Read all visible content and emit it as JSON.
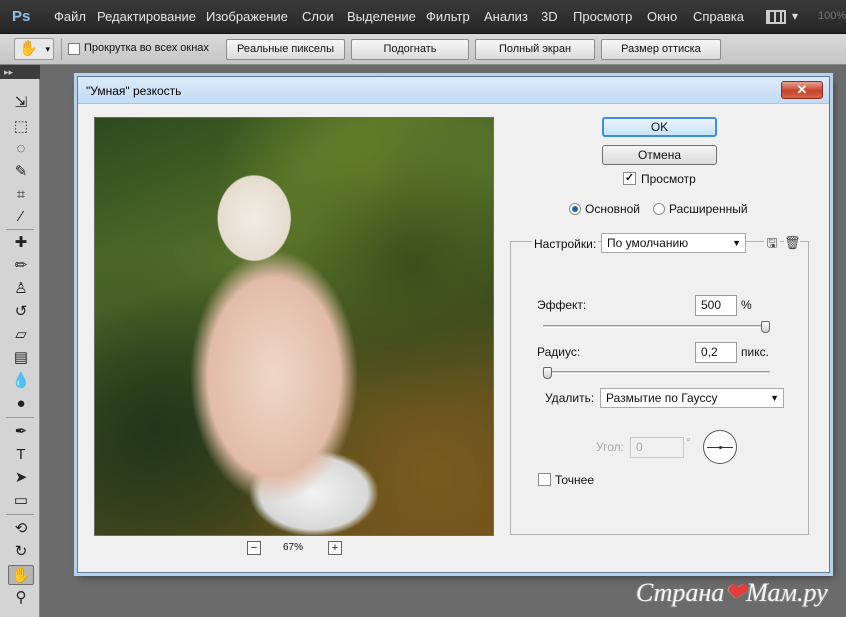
{
  "menubar": {
    "logo": "Ps",
    "items": [
      "Файл",
      "Редактирование",
      "Изображение",
      "Слои",
      "Выделение",
      "Фильтр",
      "Анализ",
      "3D",
      "Просмотр",
      "Окно",
      "Справка"
    ],
    "zoom": "100%"
  },
  "options_bar": {
    "tool_icon": "hand-icon",
    "scroll_all_label": "Прокрутка во всех окнах",
    "buttons": [
      "Реальные пикселы",
      "Подогнать",
      "Полный экран",
      "Размер оттиска"
    ]
  },
  "toolbar": {
    "header": "▸▸",
    "tools": [
      "move-icon",
      "marquee-icon",
      "lasso-icon",
      "quick-select-icon",
      "crop-icon",
      "eyedropper-icon",
      "healing-icon",
      "brush-icon",
      "stamp-icon",
      "history-brush-icon",
      "eraser-icon",
      "gradient-icon",
      "blur-icon",
      "dodge-icon",
      "pen-icon",
      "type-icon",
      "path-select-icon",
      "shape-icon",
      "3d-rotate-icon",
      "3d-orbit-icon",
      "hand-icon",
      "zoom-icon"
    ],
    "active_tool": "hand-icon"
  },
  "dialog": {
    "title": "\"Умная\" резкость",
    "ok_label": "OK",
    "cancel_label": "Отмена",
    "preview_label": "Просмотр",
    "preview_checked": true,
    "mode_basic": "Основной",
    "mode_advanced": "Расширенный",
    "mode_selected": "basic",
    "zoom_value": "67%",
    "zoom_minus": "−",
    "zoom_plus": "+",
    "settings_label": "Настройки:",
    "settings_value": "По умолчанию",
    "amount_label": "Эффект:",
    "amount_value": "500",
    "amount_unit": "%",
    "amount_fraction": 1.0,
    "radius_label": "Радиус:",
    "radius_value": "0,2",
    "radius_unit": "пикс.",
    "radius_fraction": 0.0,
    "remove_label": "Удалить:",
    "remove_value": "Размытие по Гауссу",
    "angle_label": "Угол:",
    "angle_value": "0",
    "angle_unit": "°",
    "more_accurate_label": "Точнее",
    "more_accurate_checked": false
  },
  "watermark": {
    "text_a": "Страна",
    "text_b": "Мам",
    "text_c": ".ру"
  }
}
